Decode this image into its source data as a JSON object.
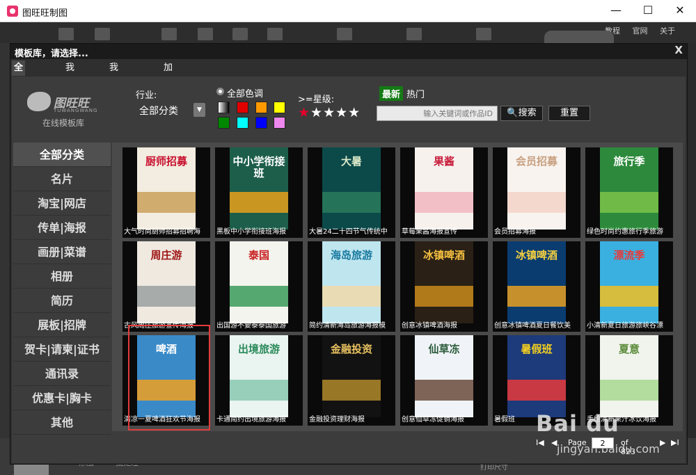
{
  "window": {
    "title": "图旺旺制图",
    "min": "—",
    "max": "☐",
    "close": "✕"
  },
  "background": {
    "links": [
      "教程",
      "官网",
      "关于"
    ],
    "bottom_add": "添加",
    "bottom_batch": "批处理",
    "bottom_print": "打印尺寸"
  },
  "dialog": {
    "title": "模板库，请选择...",
    "close": "X",
    "tabs": [
      {
        "label": "全部模板",
        "active": true
      },
      {
        "label": "我的作品"
      },
      {
        "label": "我的收藏夹"
      },
      {
        "label": "加载过的模板"
      }
    ]
  },
  "logo": {
    "text": "图旺旺",
    "sub_en": "TUWANGWANG",
    "subtitle": "在线模板库"
  },
  "filters": {
    "industry_label": "行业:",
    "industry_value": "全部分类",
    "color_label": "全部色调",
    "colors": [
      "#e00000",
      "#ff9900",
      "#ffff00",
      "#008800",
      "#00ffff",
      "#0000ff",
      "#ee88ee"
    ],
    "star_label": ">=星级:",
    "stars": "★★★★★",
    "sort_newest": "最新",
    "sort_hot": "热门",
    "search_placeholder": "输入关键词或作品ID",
    "search_button": "🔍搜索",
    "reset_button": "重置"
  },
  "sidebar": [
    {
      "label": "全部分类",
      "active": true
    },
    {
      "label": "名片"
    },
    {
      "label": "淘宝|网店"
    },
    {
      "label": "传单|海报"
    },
    {
      "label": "画册|菜谱"
    },
    {
      "label": "相册"
    },
    {
      "label": "简历"
    },
    {
      "label": "展板|招牌"
    },
    {
      "label": "贺卡|请柬|证书"
    },
    {
      "label": "通讯录"
    },
    {
      "label": "优惠卡|胸卡"
    },
    {
      "label": "其他"
    }
  ],
  "templates": [
    {
      "caption": "大气时尚厨师招募招聘海",
      "poster": "厨师招募",
      "bg": "#f3ece0",
      "fg": "#c8102e",
      "band": "#caa15a"
    },
    {
      "caption": "黑板中小学衔接班海报",
      "poster": "中小学衔接班",
      "bg": "#1d5e4a",
      "fg": "#ffffff",
      "band": "#e8a11a"
    },
    {
      "caption": "大暑24二十四节气传统中",
      "poster": "大暑",
      "bg": "#0c4a4a",
      "fg": "#d9e8c8",
      "band": "#2a7a5a"
    },
    {
      "caption": "草莓果酱海报宣传",
      "poster": "果酱",
      "bg": "#f7f1ee",
      "fg": "#c81e3c",
      "band": "#f2b6c0"
    },
    {
      "caption": "会员招募海报",
      "poster": "会员招募",
      "bg": "#f8f3ef",
      "fg": "#c8a080",
      "band": "#f3d2c8"
    },
    {
      "caption": "绿色时尚约惠旅行季旅游",
      "poster": "旅行季",
      "bg": "#2d8a3c",
      "fg": "#ffffff",
      "band": "#7cc34a"
    },
    {
      "caption": "古风周庄旅游宣传海报",
      "poster": "周庄游",
      "bg": "#efe9e0",
      "fg": "#a01818",
      "band": "#9aa0a0"
    },
    {
      "caption": "出国游不要泰泰国旅游",
      "poster": "泰国",
      "bg": "#f4f4ee",
      "fg": "#c82020",
      "band": "#3a9a5a"
    },
    {
      "caption": "简约清新海岛旅游海报模",
      "poster": "海岛旅游",
      "bg": "#bfe6ef",
      "fg": "#1a7aa0",
      "band": "#f0d8a8"
    },
    {
      "caption": "创意冰镇啤酒海报",
      "poster": "冰镇啤酒",
      "bg": "#2a2016",
      "fg": "#f5c040",
      "band": "#c88a1a"
    },
    {
      "caption": "创意冰镇啤酒夏日餐饮美",
      "poster": "冰镇啤酒",
      "bg": "#0a3c70",
      "fg": "#f5d040",
      "band": "#e8a020"
    },
    {
      "caption": "小清新夏日旅游旅峡谷漂",
      "poster": "漂流季",
      "bg": "#3ab0e0",
      "fg": "#e83a3a",
      "band": "#f2c020"
    },
    {
      "caption": "清凉一夏啤酒狂欢节海报",
      "poster": "啤酒",
      "bg": "#3a8ac8",
      "fg": "#ffffff",
      "band": "#f0a020"
    },
    {
      "caption": "卡通简约出境旅游海报",
      "poster": "出境旅游",
      "bg": "#eaf4f0",
      "fg": "#2a8a5a",
      "band": "#8ac8b0"
    },
    {
      "caption": "金融投资理财海报",
      "poster": "金融投资",
      "bg": "#121212",
      "fg": "#e8c060",
      "band": "#b08a2a"
    },
    {
      "caption": "创意仙草冻促销海报",
      "poster": "仙草冻",
      "bg": "#f0f4f8",
      "fg": "#2a5a3a",
      "band": "#6a4a3a"
    },
    {
      "caption": "暑假班",
      "poster": "暑假班",
      "bg": "#1d3a7a",
      "fg": "#f5d020",
      "band": "#e83a3a"
    },
    {
      "caption": "手绘清新果汁冰饮海报",
      "poster": "夏意",
      "bg": "#f0f4ec",
      "fg": "#5a8a3a",
      "band": "#a8d890"
    }
  ],
  "pager": {
    "first": "I◀",
    "prev": "◀",
    "page_label": "Page",
    "page_value": "2",
    "of": "of 823",
    "next": "▶",
    "last": "▶I"
  },
  "watermark": {
    "brand": "Bai du",
    "url": "jingyan.baidu.com"
  }
}
